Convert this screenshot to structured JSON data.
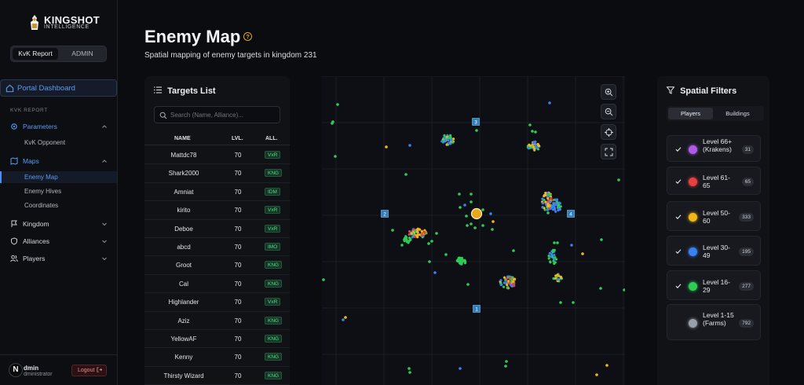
{
  "brand": {
    "title": "KINGSHOT",
    "subtitle": "INTELLIGENCE"
  },
  "mode_toggle": {
    "options": [
      "KvK Report",
      "ADMIN"
    ],
    "active": "KvK Report"
  },
  "sidebar": {
    "portal_label": "Portal Dashboard",
    "section_label": "KVK REPORT",
    "items": [
      {
        "label": "Parameters",
        "icon": "gear-icon",
        "expanded": true,
        "children": [
          "KvK Opponent"
        ]
      },
      {
        "label": "Maps",
        "icon": "map-icon",
        "expanded": true,
        "children": [
          "Enemy Map",
          "Enemy Hives",
          "Coordinates"
        ],
        "active_child": "Enemy Map"
      },
      {
        "label": "Kingdom",
        "icon": "flag-icon",
        "expanded": false
      },
      {
        "label": "Alliances",
        "icon": "shield-icon",
        "expanded": false
      },
      {
        "label": "Players",
        "icon": "users-icon",
        "expanded": false
      }
    ],
    "user": {
      "avatar_letter": "N",
      "name": "dmin",
      "role": "dministrator",
      "logout_label": "Logout"
    }
  },
  "page": {
    "title": "Enemy Map",
    "help_icon": "?",
    "subtitle": "Spatial mapping of enemy targets in kingdom 231"
  },
  "targets": {
    "title": "Targets List",
    "search_placeholder": "Search (Name, Alliance)...",
    "columns": [
      "NAME",
      "LVL.",
      "ALL."
    ],
    "rows": [
      {
        "name": "Mattdc78",
        "lvl": "70",
        "alliance": "VxR"
      },
      {
        "name": "Shark2000",
        "lvl": "70",
        "alliance": "KNG"
      },
      {
        "name": "Amniat",
        "lvl": "70",
        "alliance": "IDM"
      },
      {
        "name": "kirito",
        "lvl": "70",
        "alliance": "VxR"
      },
      {
        "name": "Deboe",
        "lvl": "70",
        "alliance": "VxR"
      },
      {
        "name": "abcd",
        "lvl": "70",
        "alliance": "IMO"
      },
      {
        "name": "Groot",
        "lvl": "70",
        "alliance": "KNG"
      },
      {
        "name": "Cal",
        "lvl": "70",
        "alliance": "KNG"
      },
      {
        "name": "Highlander",
        "lvl": "70",
        "alliance": "VxR"
      },
      {
        "name": "Aziz",
        "lvl": "70",
        "alliance": "KNG"
      },
      {
        "name": "YellowAF",
        "lvl": "70",
        "alliance": "KNG"
      },
      {
        "name": "Kenny",
        "lvl": "70",
        "alliance": "KNG"
      },
      {
        "name": "Thirsty Wizard",
        "lvl": "70",
        "alliance": "KNG"
      }
    ]
  },
  "map": {
    "markers": [
      "3",
      "2",
      "4",
      "1"
    ],
    "controls": [
      "zoom-in-icon",
      "zoom-out-icon",
      "crosshair-icon",
      "fullscreen-icon"
    ]
  },
  "filters": {
    "title": "Spatial Filters",
    "tabs": [
      "Players",
      "Buildings"
    ],
    "active_tab": "Players",
    "levels": [
      {
        "label": "Level 66+ (Krakens)",
        "count": "31",
        "color": "#b05be8",
        "checked": true
      },
      {
        "label": "Level 61-65",
        "count": "65",
        "color": "#e84040",
        "checked": true
      },
      {
        "label": "Level 50-60",
        "count": "333",
        "color": "#f2b817",
        "checked": true
      },
      {
        "label": "Level 30-49",
        "count": "195",
        "color": "#3a82f0",
        "checked": true
      },
      {
        "label": "Level 16-29",
        "count": "277",
        "color": "#2ecc55",
        "checked": true
      },
      {
        "label": "Level 1-15 (Farms)",
        "count": "792",
        "color": "#9aa0aa",
        "checked": false
      }
    ]
  }
}
